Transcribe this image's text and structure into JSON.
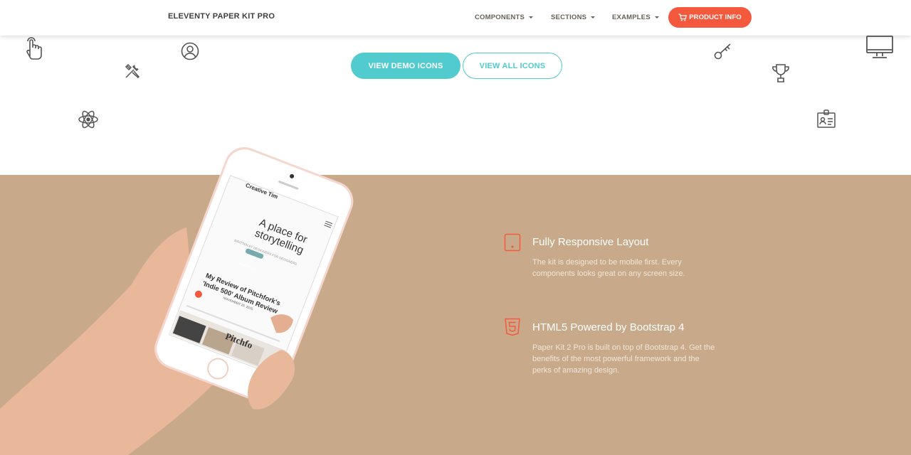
{
  "navbar": {
    "brand": "ELEVENTY PAPER KIT PRO",
    "items": [
      {
        "label": "COMPONENTS"
      },
      {
        "label": "SECTIONS"
      },
      {
        "label": "EXAMPLES"
      }
    ],
    "product_button": "PRODUCT INFO"
  },
  "hero": {
    "view_demo_label": "VIEW DEMO ICONS",
    "view_all_label": "VIEW ALL ICONS"
  },
  "features": {
    "items": [
      {
        "title": "Fully Responsive Layout",
        "description": "The kit is designed to be mobile first. Every components looks great on any screen size.",
        "icon": "tablet-icon"
      },
      {
        "title": "HTML5 Powered by Bootstrap 4",
        "description": "Paper Kit 2 Pro is built on top of Bootstrap 4. Get the benefits of the most powerful framework and the perks of amazing design.",
        "icon": "html5-icon"
      }
    ]
  },
  "phone_screen": {
    "brand": "Creative Tim",
    "headline_line1": "A place for",
    "headline_line2": "storytelling",
    "tagline": "WRITTEN BY DESIGNERS FOR DESIGNERS",
    "badge": "FEATURED",
    "article_line1": "My Review of Pitchfork's",
    "article_line2": "'Indie 500' Album Review",
    "article_date": "NOVEMBER 20, 2015",
    "logo": "Pitchfo"
  },
  "colors": {
    "accent_teal": "#51cbce",
    "accent_orange": "#f5593d",
    "section_bg": "#c8aa8b"
  }
}
